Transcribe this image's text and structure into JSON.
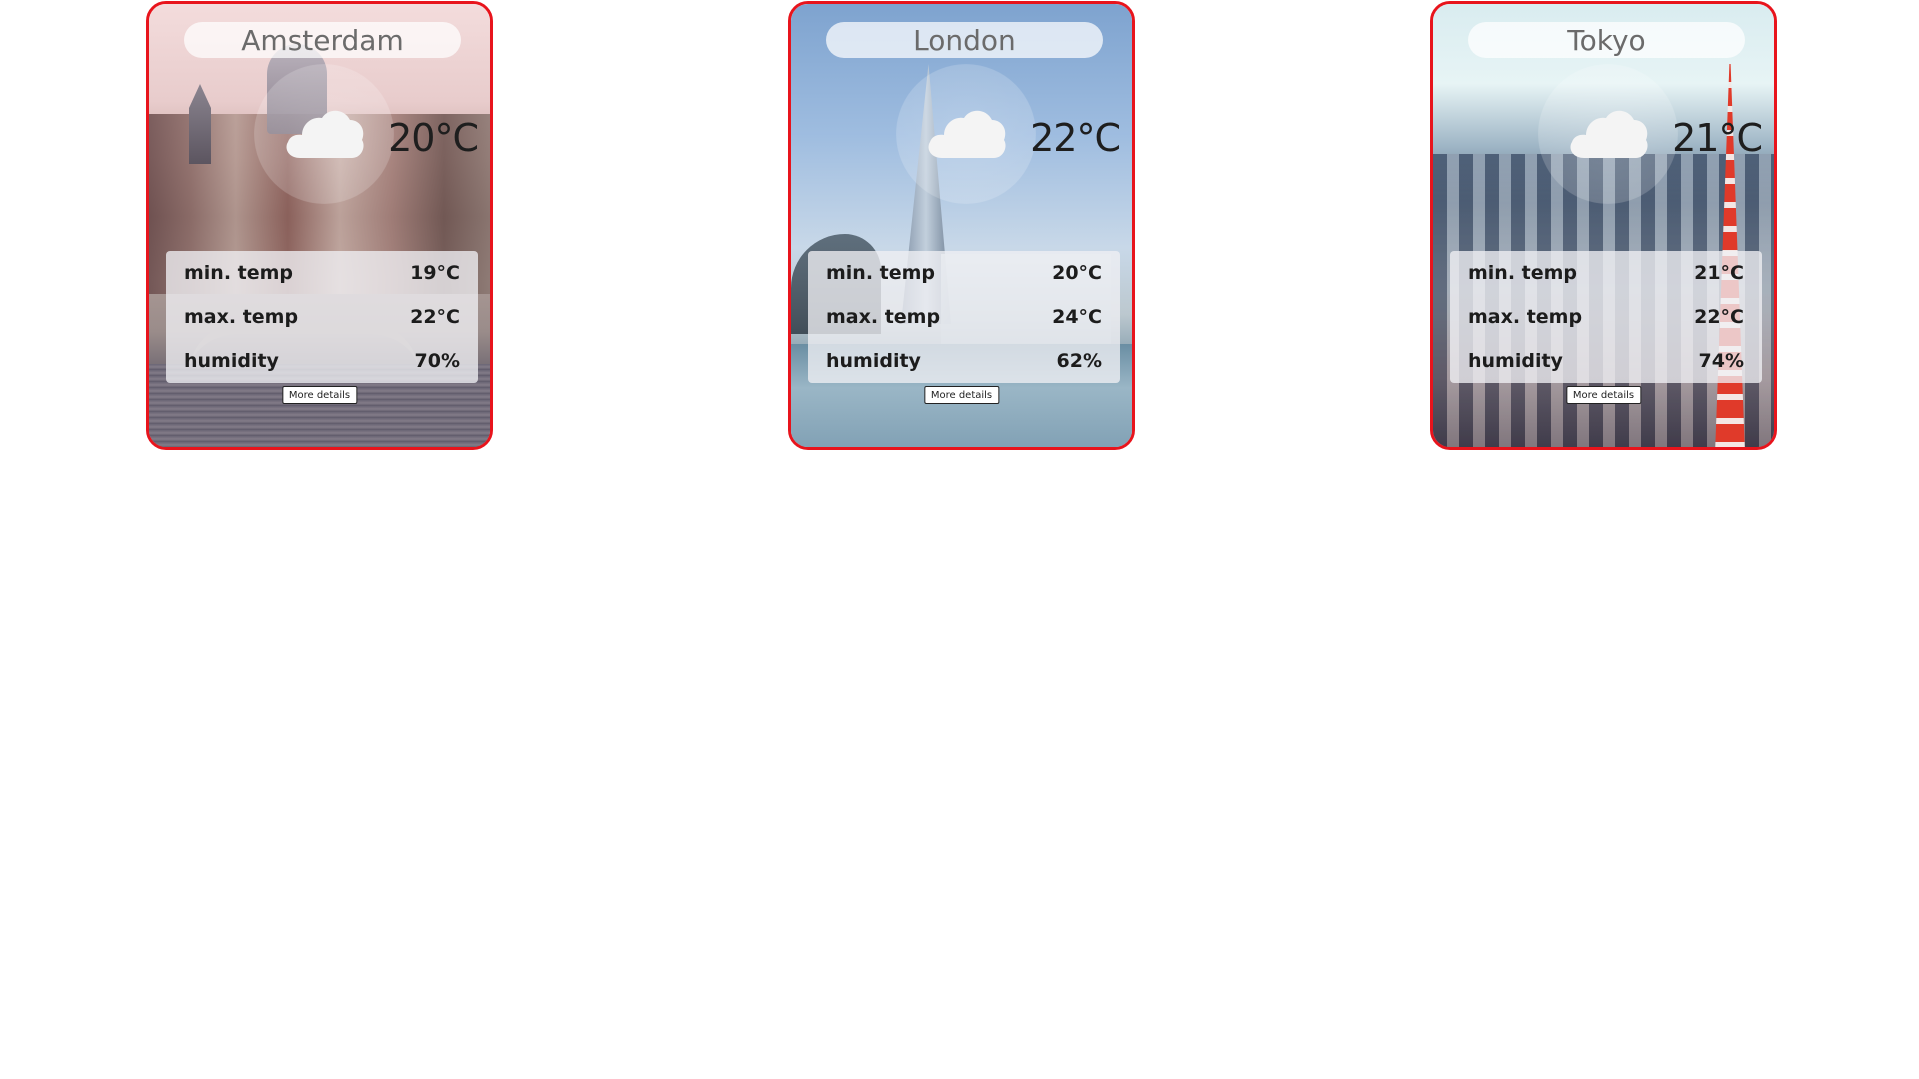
{
  "cards": [
    {
      "city": "Amsterdam",
      "temp": "20°C",
      "icon": "cloud-icon",
      "min_label": "min. temp",
      "min_value": "19°C",
      "max_label": "max. temp",
      "max_value": "22°C",
      "humidity_label": "humidity",
      "humidity_value": "70%",
      "button_label": "More details"
    },
    {
      "city": "London",
      "temp": "22°C",
      "icon": "cloud-icon",
      "min_label": "min. temp",
      "min_value": "20°C",
      "max_label": "max. temp",
      "max_value": "24°C",
      "humidity_label": "humidity",
      "humidity_value": "62%",
      "button_label": "More details"
    },
    {
      "city": "Tokyo",
      "temp": "21°C",
      "icon": "cloud-icon",
      "min_label": "min. temp",
      "min_value": "21°C",
      "max_label": "max. temp",
      "max_value": "22°C",
      "humidity_label": "humidity",
      "humidity_value": "74%",
      "button_label": "More details"
    }
  ],
  "colors": {
    "card_border": "#e8141c",
    "cloud": "#f4f4f4"
  }
}
